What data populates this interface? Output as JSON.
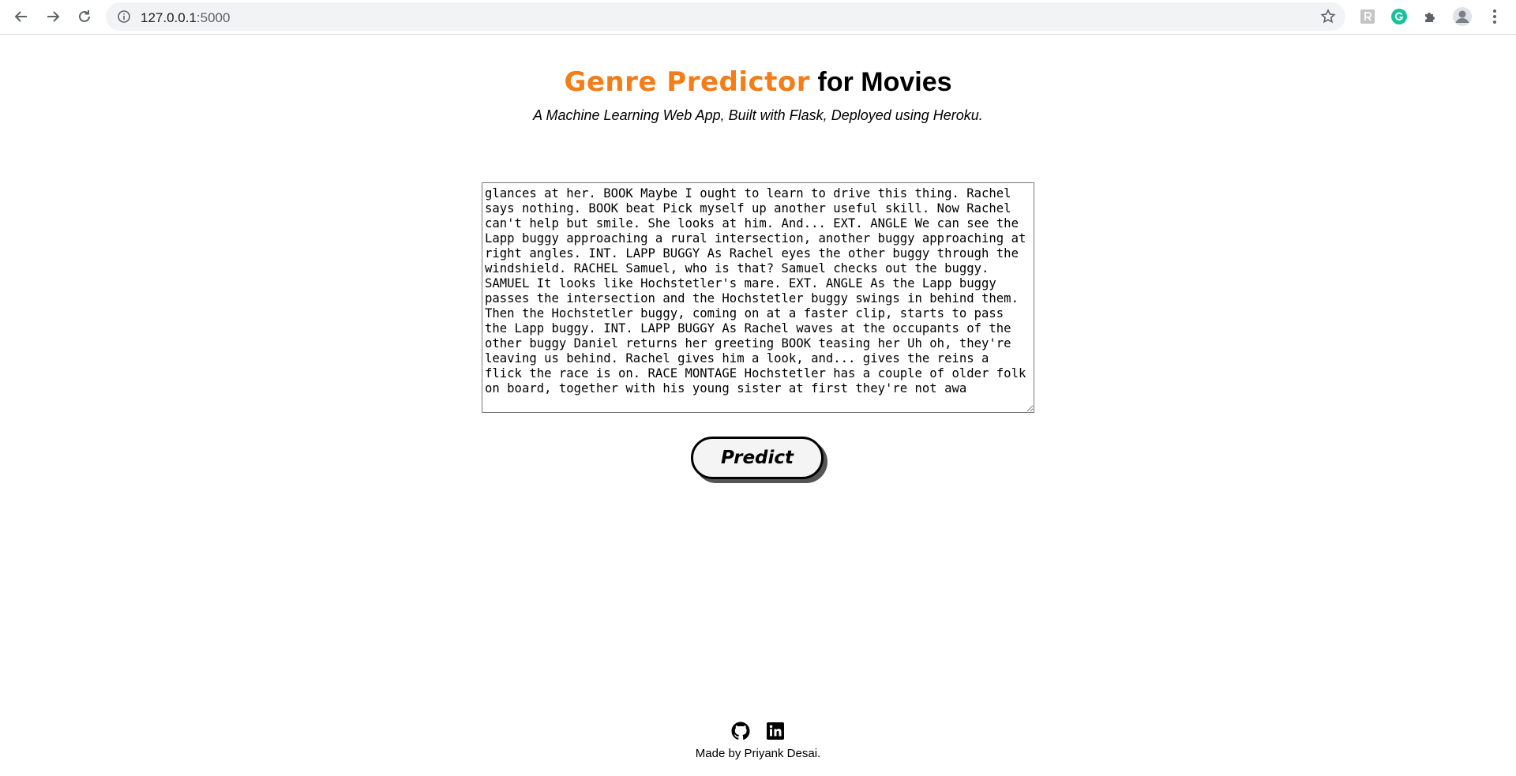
{
  "browser": {
    "url_host": "127.0.0.1",
    "url_port": ":5000"
  },
  "header": {
    "title_brand": "Genre Predictor",
    "title_rest": " for Movies",
    "subtitle": "A Machine Learning Web App, Built with Flask, Deployed using Heroku."
  },
  "form": {
    "script_text": "glances at her. BOOK Maybe I ought to learn to drive this thing. Rachel says nothing. BOOK beat Pick myself up another useful skill. Now Rachel can't help but smile. She looks at him. And... EXT. ANGLE We can see the Lapp buggy approaching a rural intersection, another buggy approaching at right angles. INT. LAPP BUGGY As Rachel eyes the other buggy through the windshield. RACHEL Samuel, who is that? Samuel checks out the buggy. SAMUEL It looks like Hochstetler's mare. EXT. ANGLE As the Lapp buggy passes the intersection and the Hochstetler buggy swings in behind them. Then the Hochstetler buggy, coming on at a faster clip, starts to pass the Lapp buggy. INT. LAPP BUGGY As Rachel waves at the occupants of the other buggy Daniel returns her greeting BOOK teasing her Uh oh, they're leaving us behind. Rachel gives him a look, and... gives the reins a flick the race is on. RACE MONTAGE Hochstetler has a couple of older folk on board, together with his young sister at first they're not awa",
    "predict_label": "Predict"
  },
  "footer": {
    "credit": "Made by Priyank Desai."
  },
  "colors": {
    "brand": "#f57c16",
    "grammarly": "#15c39a"
  }
}
